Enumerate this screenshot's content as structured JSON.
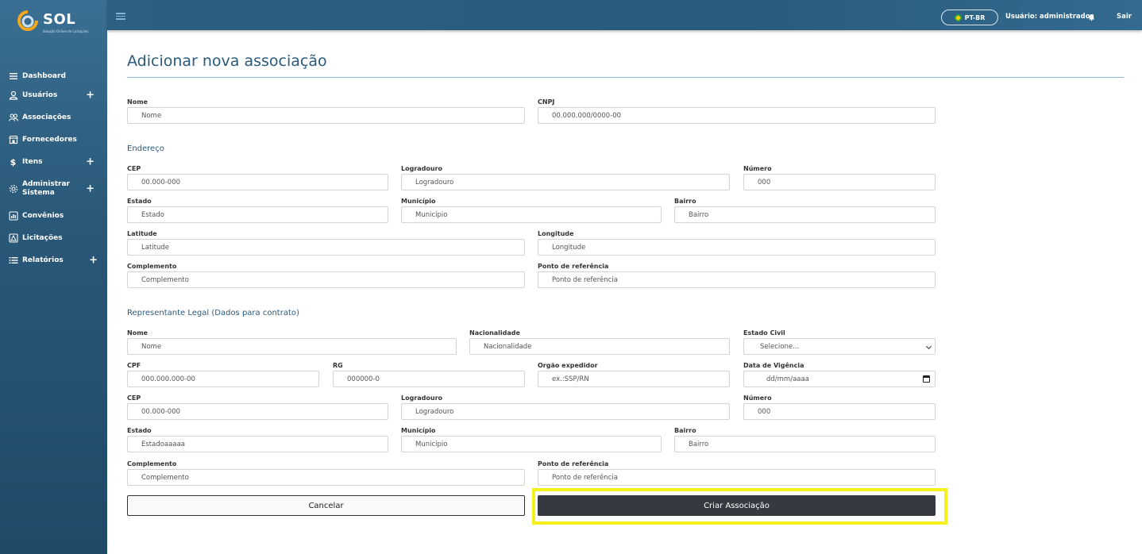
{
  "brand": {
    "name": "SOL",
    "tagline": "Solução Online de Licitações"
  },
  "sidebar": {
    "items": [
      {
        "label": "Dashboard",
        "icon": "list-icon",
        "expandable": false
      },
      {
        "label": "Usuários",
        "icon": "user-icon",
        "expandable": true
      },
      {
        "label": "Associações",
        "icon": "users-icon",
        "expandable": false
      },
      {
        "label": "Fornecedores",
        "icon": "store-icon",
        "expandable": false
      },
      {
        "label": "Itens",
        "icon": "dollar-icon",
        "expandable": true
      },
      {
        "label": "Administrar Sistema",
        "icon": "gear-icon",
        "expandable": true
      },
      {
        "label": "Convênios",
        "icon": "chart-icon",
        "expandable": false
      },
      {
        "label": "Licitações",
        "icon": "building-icon",
        "expandable": false
      },
      {
        "label": "Relatórios",
        "icon": "list-check-icon",
        "expandable": true
      }
    ],
    "plus": "+"
  },
  "topbar": {
    "language": "PT-BR",
    "user": "Usuário: administrador",
    "logout": "Sair"
  },
  "page": {
    "title": "Adicionar nova associação"
  },
  "association": {
    "name_label": "Nome",
    "name_placeholder": "Nome",
    "cnpj_label": "CNPJ",
    "cnpj_placeholder": "00.000.000/0000-00"
  },
  "address": {
    "section_title": "Endereço",
    "cep_label": "CEP",
    "cep_placeholder": "00.000-000",
    "street_label": "Logradouro",
    "street_placeholder": "Logradouro",
    "number_label": "Número",
    "number_placeholder": "000",
    "state_label": "Estado",
    "state_placeholder": "Estado",
    "city_label": "Município",
    "city_placeholder": "Município",
    "district_label": "Bairro",
    "district_placeholder": "Bairro",
    "lat_label": "Latitude",
    "lat_placeholder": "Latitude",
    "lng_label": "Longitude",
    "lng_placeholder": "Longitude",
    "complement_label": "Complemento",
    "complement_placeholder": "Complemento",
    "reference_label": "Ponto de referência",
    "reference_placeholder": "Ponto de referência"
  },
  "representative": {
    "section_title": "Representante Legal (Dados para contrato)",
    "name_label": "Nome",
    "name_placeholder": "Nome",
    "nationality_label": "Nacionalidade",
    "nationality_placeholder": "Nacionalidade",
    "civil_label": "Estado Civil",
    "civil_value": "Selecione...",
    "cpf_label": "CPF",
    "cpf_placeholder": "000.000.000-00",
    "rg_label": "RG",
    "rg_placeholder": "000000-0",
    "issuer_label": "Orgão expedidor",
    "issuer_placeholder": "ex.:SSP/RN",
    "validity_label": "Data de Vigência",
    "validity_placeholder": "dd/mm/aaaa",
    "cep_label": "CEP",
    "cep_placeholder": "00.000-000",
    "street_label": "Logradouro",
    "street_placeholder": "Logradouro",
    "number_label": "Número",
    "number_placeholder": "000",
    "state_label": "Estado",
    "state_value": "Estadoaaaaa",
    "city_label": "Município",
    "city_placeholder": "Municipio",
    "district_label": "Bairro",
    "district_placeholder": "Bairro",
    "complement_label": "Complemento",
    "complement_placeholder": "Complemento",
    "reference_label": "Ponto de referência",
    "reference_placeholder": "Ponto de referência"
  },
  "actions": {
    "cancel": "Cancelar",
    "create": "Criar Associação"
  },
  "colors": {
    "sidebar_top": "#3a6f93",
    "sidebar_bottom": "#1f4a68",
    "topbar": "#2d5f82",
    "title": "#2a5a7c",
    "primary_button": "#343a40",
    "highlight": "#f5ef1b"
  }
}
